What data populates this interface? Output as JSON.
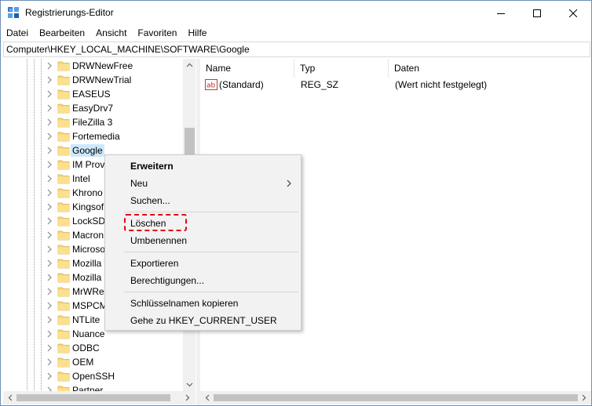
{
  "window": {
    "title": "Registrierungs-Editor",
    "minimize_icon": "minimize-icon",
    "maximize_icon": "maximize-icon",
    "close_icon": "close-icon"
  },
  "menubar": {
    "items": [
      "Datei",
      "Bearbeiten",
      "Ansicht",
      "Favoriten",
      "Hilfe"
    ]
  },
  "address": {
    "path": "Computer\\HKEY_LOCAL_MACHINE\\SOFTWARE\\Google"
  },
  "tree": {
    "items": [
      {
        "label": "DRWNewFree",
        "selected": false
      },
      {
        "label": "DRWNewTrial",
        "selected": false
      },
      {
        "label": "EASEUS",
        "selected": false
      },
      {
        "label": "EasyDrv7",
        "selected": false
      },
      {
        "label": "FileZilla 3",
        "selected": false
      },
      {
        "label": "Fortemedia",
        "selected": false
      },
      {
        "label": "Google",
        "selected": true
      },
      {
        "label": "IM Prov",
        "selected": false
      },
      {
        "label": "Intel",
        "selected": false
      },
      {
        "label": "Khrono",
        "selected": false
      },
      {
        "label": "Kingsof",
        "selected": false
      },
      {
        "label": "LockSD",
        "selected": false
      },
      {
        "label": "Macron",
        "selected": false
      },
      {
        "label": "Microso",
        "selected": false
      },
      {
        "label": "Mozilla",
        "selected": false
      },
      {
        "label": "Mozilla",
        "selected": false
      },
      {
        "label": "MrWRe",
        "selected": false
      },
      {
        "label": "MSPCM",
        "selected": false
      },
      {
        "label": "NTLite",
        "selected": false
      },
      {
        "label": "Nuance",
        "selected": false
      },
      {
        "label": "ODBC",
        "selected": false
      },
      {
        "label": "OEM",
        "selected": false
      },
      {
        "label": "OpenSSH",
        "selected": false
      },
      {
        "label": "Partner",
        "selected": false
      }
    ]
  },
  "list": {
    "columns": [
      "Name",
      "Typ",
      "Daten"
    ],
    "rows": [
      {
        "name": "(Standard)",
        "type": "REG_SZ",
        "data": "(Wert nicht festgelegt)",
        "icon": "string-value-icon"
      }
    ]
  },
  "context_menu": {
    "items": [
      {
        "label": "Erweitern",
        "bold": true
      },
      {
        "label": "Neu",
        "submenu": true
      },
      {
        "label": "Suchen..."
      },
      {
        "label": "Löschen",
        "highlighted": true
      },
      {
        "label": "Umbenennen"
      },
      {
        "label": "Exportieren"
      },
      {
        "label": "Berechtigungen..."
      },
      {
        "label": "Schlüsselnamen kopieren"
      },
      {
        "label": "Gehe zu HKEY_CURRENT_USER"
      }
    ],
    "highlight_color": "#e0001b"
  },
  "colors": {
    "selection": "#cce8ff",
    "folder": "#f7d674",
    "menu_bg": "#f2f2f2"
  }
}
